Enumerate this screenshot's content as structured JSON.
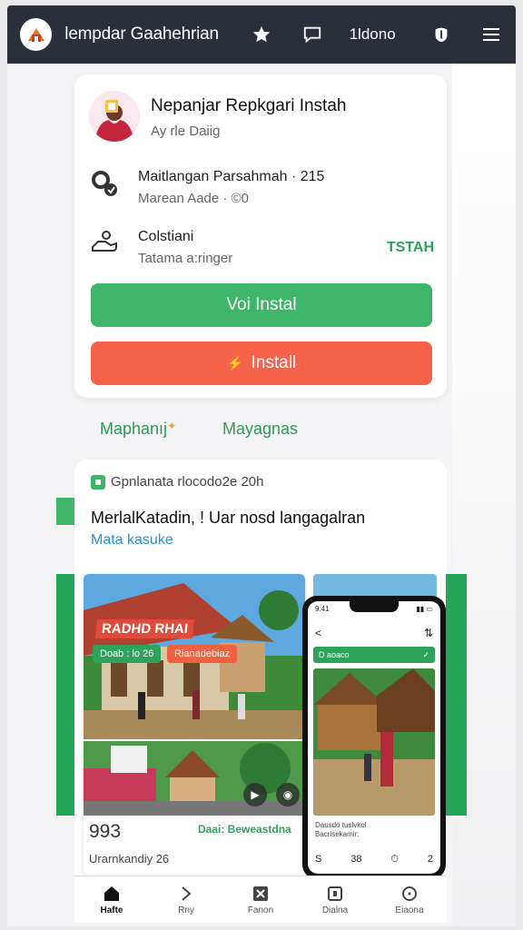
{
  "header": {
    "title": "lempdar Gaahehrian",
    "text_item": "1ldono",
    "icons": [
      "logo-icon",
      "star-icon",
      "chat-icon",
      "shield-icon",
      "menu-icon"
    ]
  },
  "app": {
    "name": "Nepanjar Repkgari Instah",
    "subtitle": "Ay rle Daiig",
    "row1": {
      "title": "Maitlangan Parsahmah · 215",
      "subtitle": "Marean Aade · ©0"
    },
    "row2": {
      "title": "Colstiani",
      "subtitle": "Tatama a:ringer",
      "badge": "TSTAH"
    },
    "primary_button": "Voi Instal",
    "install_button": "Install"
  },
  "links": {
    "first": "Maphanıj",
    "second": "Mayagnas"
  },
  "info": {
    "meta": "Gpnlanata rlocodo2e 20h",
    "headline": "MerlalKatadin, ! Uar nosd langagalran",
    "link": "Mata kasuke"
  },
  "promo": {
    "title": "RADHD RHAI",
    "chip1": "Doab : lo 26",
    "chip2": "Rianadebiaz",
    "price": "993",
    "green_text": "Daai: Beweastdna",
    "caption": "Urarnkandiy 26"
  },
  "phone": {
    "time": "9:41",
    "bar_label": "D aoaco",
    "caption_line1": "Dausdo tuslvkol",
    "caption_line2": "Bacrisekamir:",
    "bottom_left": "S",
    "bottom_num": "38",
    "bottom_right": "2"
  },
  "bottom_nav": [
    {
      "label": "Hafte",
      "icon": "home-icon",
      "active": true
    },
    {
      "label": "Rny",
      "icon": "arrow-icon",
      "active": false
    },
    {
      "label": "Fanon",
      "icon": "expand-icon",
      "active": false
    },
    {
      "label": "Dialna",
      "icon": "bracket-icon",
      "active": false
    },
    {
      "label": "Eiaona",
      "icon": "circle-icon",
      "active": false
    }
  ],
  "colors": {
    "green": "#3fb56a",
    "orange": "#f7634a",
    "header": "#2b2f3a",
    "link_blue": "#2b8fd6"
  }
}
